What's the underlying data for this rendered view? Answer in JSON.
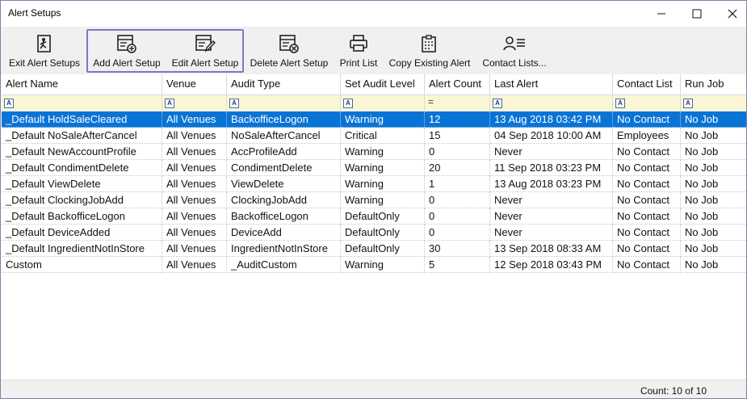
{
  "window": {
    "title": "Alert Setups"
  },
  "toolbar": [
    {
      "label": "Exit Alert Setups",
      "icon": "exit-person-icon"
    },
    {
      "label": "Add Alert Setup",
      "icon": "add-list-icon"
    },
    {
      "label": "Edit Alert Setup",
      "icon": "edit-list-icon"
    },
    {
      "label": "Delete Alert Setup",
      "icon": "delete-list-icon"
    },
    {
      "label": "Print List",
      "icon": "printer-icon"
    },
    {
      "label": "Copy Existing Alert",
      "icon": "copy-clipboard-icon"
    },
    {
      "label": "Contact Lists...",
      "icon": "contact-list-icon"
    }
  ],
  "columns": [
    "Alert Name",
    "Venue",
    "Audit Type",
    "Set Audit Level",
    "Alert Count",
    "Last Alert",
    "Contact List",
    "Run Job"
  ],
  "rows": [
    [
      "_Default HoldSaleCleared",
      "All Venues",
      "BackofficeLogon",
      "Warning",
      "12",
      "13 Aug 2018 03:42 PM",
      "No Contact",
      "No Job"
    ],
    [
      "_Default NoSaleAfterCancel",
      "All Venues",
      "NoSaleAfterCancel",
      "Critical",
      "15",
      "04 Sep 2018 10:00 AM",
      "Employees",
      "No Job"
    ],
    [
      "_Default NewAccountProfile",
      "All Venues",
      "AccProfileAdd",
      "Warning",
      "0",
      "Never",
      "No Contact",
      "No Job"
    ],
    [
      "_Default CondimentDelete",
      "All Venues",
      "CondimentDelete",
      "Warning",
      "20",
      "11 Sep 2018 03:23 PM",
      "No Contact",
      "No Job"
    ],
    [
      "_Default ViewDelete",
      "All Venues",
      "ViewDelete",
      "Warning",
      "1",
      "13 Aug 2018 03:23 PM",
      "No Contact",
      "No Job"
    ],
    [
      "_Default ClockingJobAdd",
      "All Venues",
      "ClockingJobAdd",
      "Warning",
      "0",
      "Never",
      "No Contact",
      "No Job"
    ],
    [
      "_Default BackofficeLogon",
      "All Venues",
      "BackofficeLogon",
      "DefaultOnly",
      "0",
      "Never",
      "No Contact",
      "No Job"
    ],
    [
      "_Default DeviceAdded",
      "All Venues",
      "DeviceAdd",
      "DefaultOnly",
      "0",
      "Never",
      "No Contact",
      "No Job"
    ],
    [
      "_Default IngredientNotInStore",
      "All Venues",
      "IngredientNotInStore",
      "DefaultOnly",
      "30",
      "13 Sep 2018 08:33 AM",
      "No Contact",
      "No Job"
    ],
    [
      "Custom",
      "All Venues",
      "_AuditCustom",
      "Warning",
      "5",
      "12 Sep 2018 03:43 PM",
      "No Contact",
      "No Job"
    ]
  ],
  "selected_row": 0,
  "status": {
    "count": "Count: 10 of 10"
  },
  "colors": {
    "selection": "#0a74d6",
    "filter_row": "#fbf6d6",
    "highlight_box": "#7b78c6"
  }
}
